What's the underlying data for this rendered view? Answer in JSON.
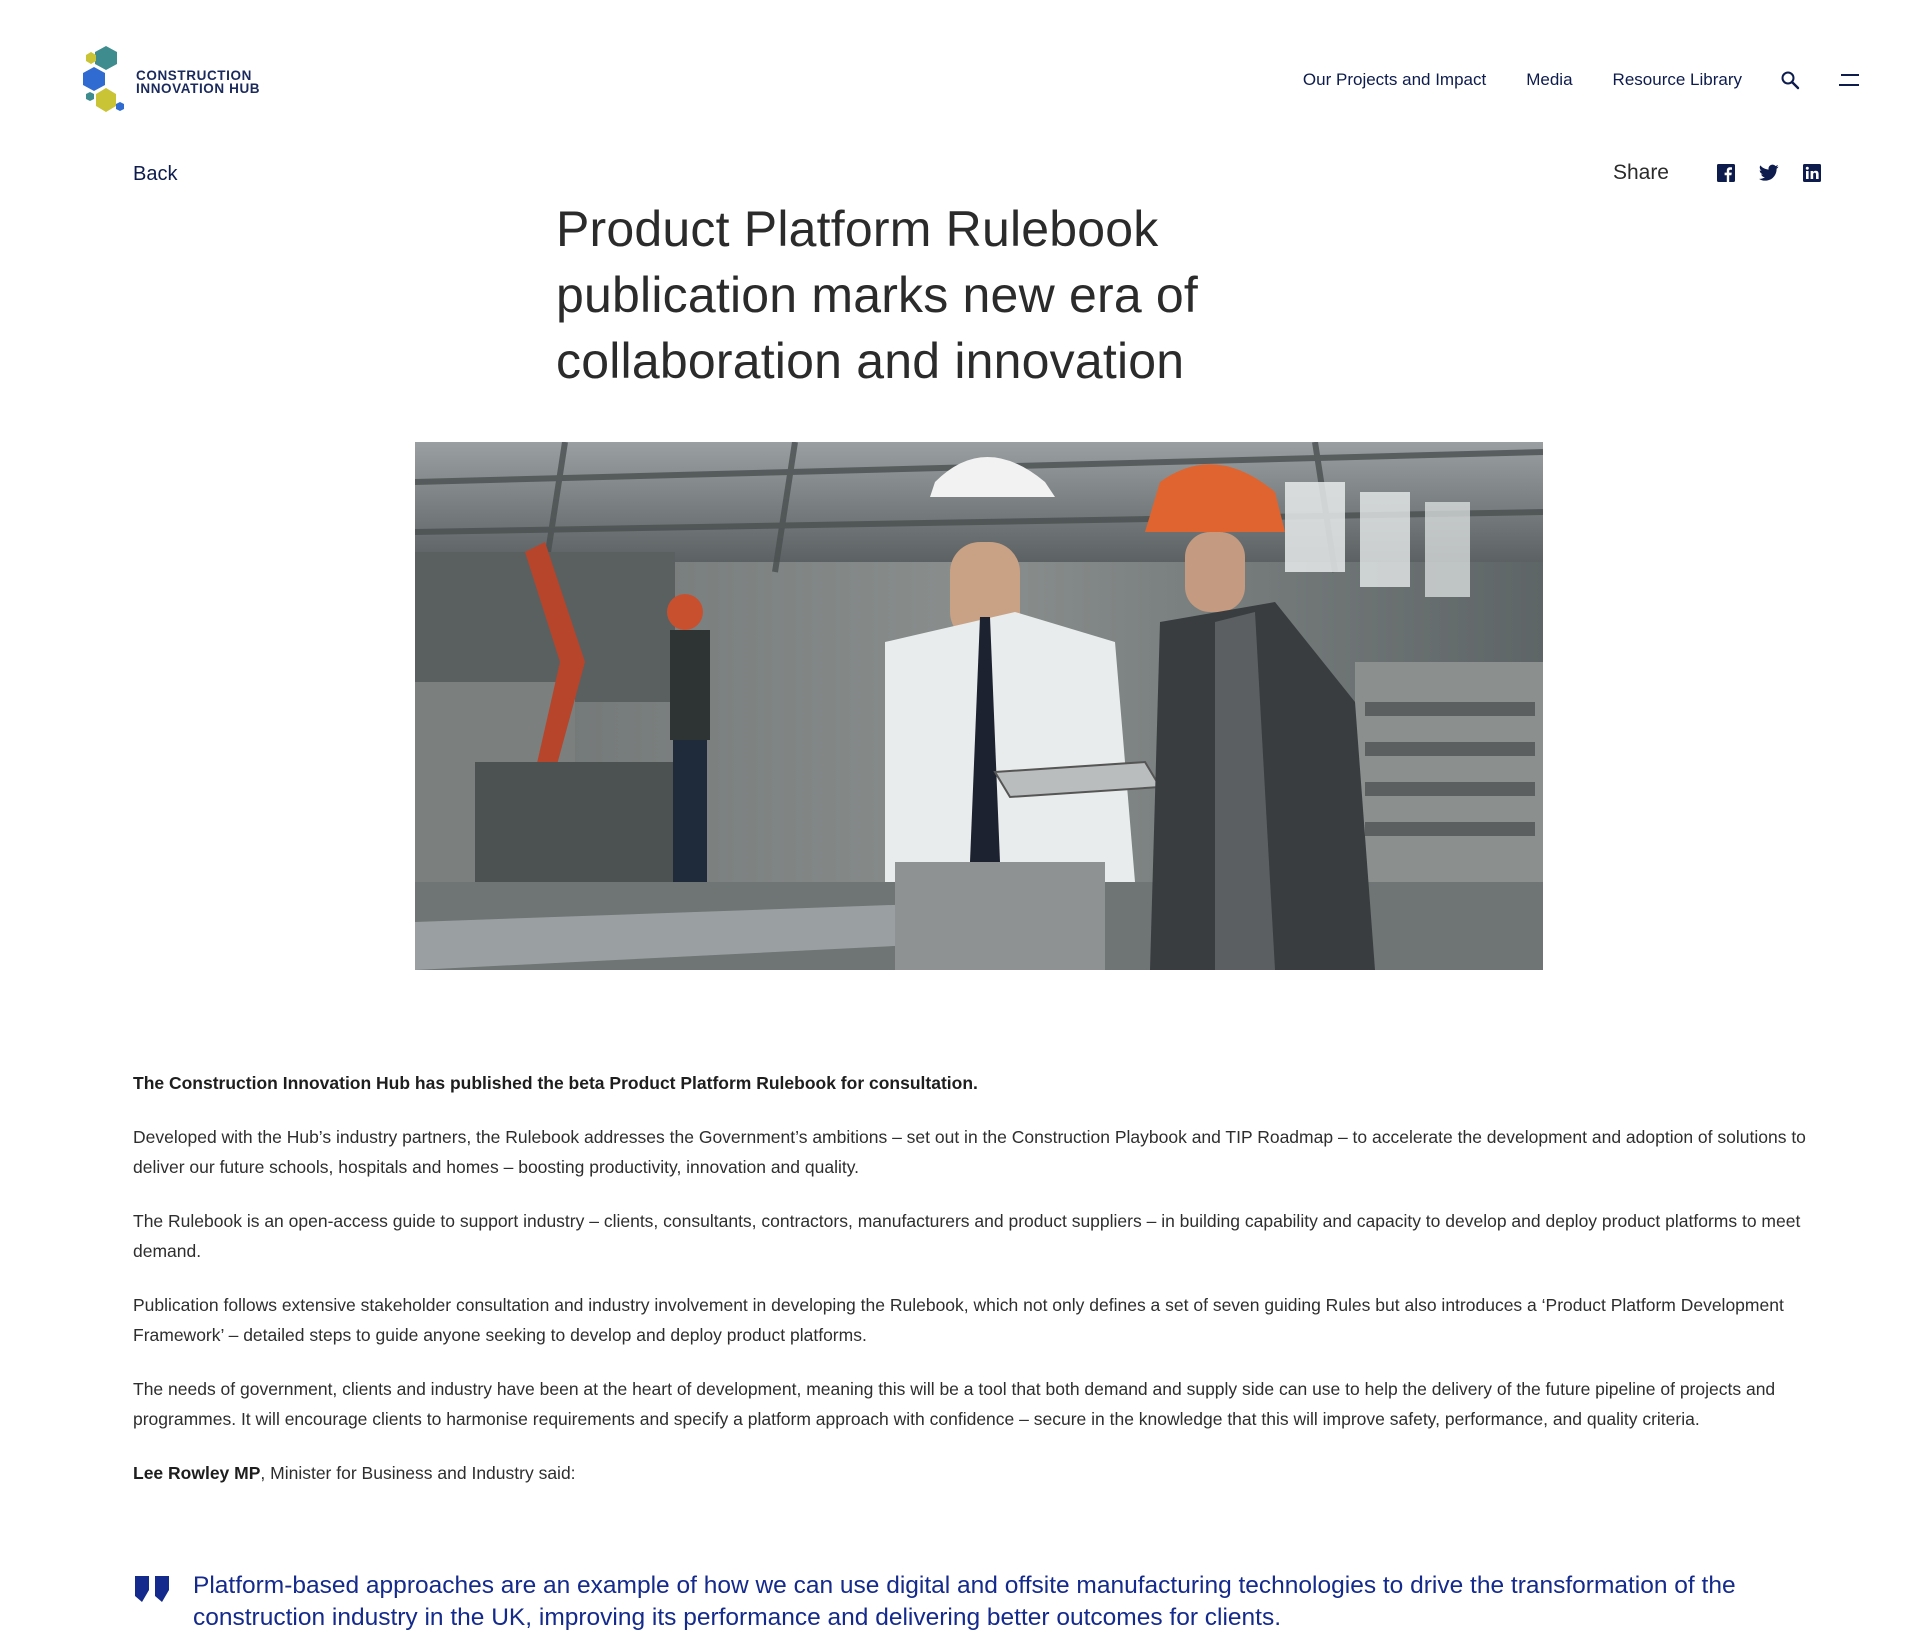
{
  "brand": {
    "line1": "CONSTRUCTION",
    "line2": "INNOVATION HUB",
    "logo_icon": "hexagon-cluster-logo",
    "colors": {
      "navy": "#0d1b4d",
      "teal": "#3f8c8f",
      "blue": "#2f6bd1",
      "olive": "#c8c436",
      "quote_blue": "#142a8c"
    }
  },
  "nav": {
    "items": [
      "Our Projects and Impact",
      "Media",
      "Resource Library"
    ],
    "search_icon": "search-icon",
    "menu_icon": "hamburger-menu-icon"
  },
  "page": {
    "back_label": "Back",
    "share_label": "Share",
    "share_icons": [
      "facebook-icon",
      "twitter-icon",
      "linkedin-icon"
    ],
    "title": "Product Platform Rulebook publication marks new era of collaboration and innovation"
  },
  "article": {
    "lead": "The Construction Innovation Hub has published the beta Product Platform Rulebook for consultation.",
    "paragraphs": [
      "Developed with the Hub’s industry partners, the Rulebook addresses the Government’s ambitions – set out in the Construction Playbook and TIP Roadmap – to accelerate the development and adoption of solutions to deliver our future schools, hospitals and homes – boosting productivity, innovation and quality.",
      "The Rulebook is an open-access guide to support industry – clients, consultants, contractors, manufacturers and product suppliers – in building capability and capacity to develop and deploy product platforms to meet demand.",
      "Publication follows extensive stakeholder consultation and industry involvement in developing the Rulebook, which not only defines a set of seven guiding Rules but also introduces a ‘Product Platform Development Framework’ – detailed steps to guide anyone seeking to develop and deploy product platforms.",
      "The needs of government, clients and industry have been at the heart of development, meaning this will be a tool that both demand and supply side can use to help the delivery of the future pipeline of projects and programmes. It will encourage clients to harmonise requirements and specify a platform approach with confidence – secure in the knowledge that this will improve safety, performance, and quality criteria."
    ],
    "speaker_name": "Lee Rowley MP",
    "speaker_rest": ", Minister for Business and Industry said:",
    "quote": "Platform-based approaches are an example of how we can use digital and offsite manufacturing technologies to drive the transformation of the construction industry in the UK, improving its performance and delivering better outcomes for clients."
  }
}
